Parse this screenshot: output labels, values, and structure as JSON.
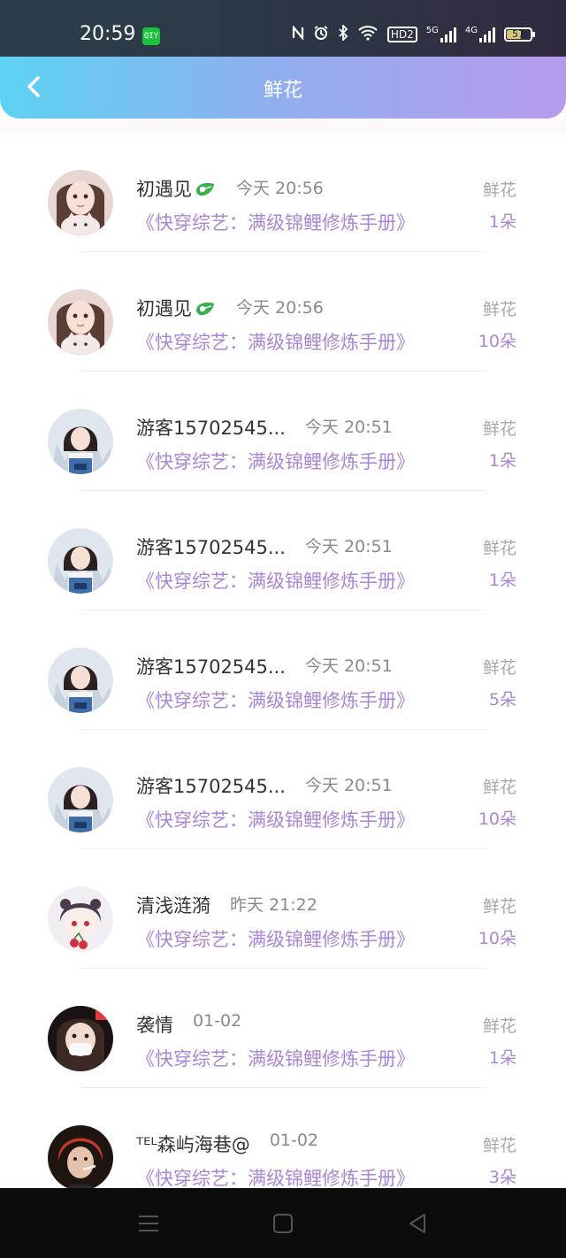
{
  "status_bar": {
    "time": "20:59",
    "app_badge": "QIY",
    "hd_label": "HD2",
    "net1_label": "5G",
    "net2_label": "4G",
    "battery": "57"
  },
  "header": {
    "title": "鲜花"
  },
  "items": [
    {
      "name": "初遇见",
      "has_leaf": true,
      "time": "今天 20:56",
      "book": "《快穿综艺：满级锦鲤修炼手册》",
      "label": "鲜花",
      "count": "1朵",
      "avatar": "girl-cat"
    },
    {
      "name": "初遇见",
      "has_leaf": true,
      "time": "今天 20:56",
      "book": "《快穿综艺：满级锦鲤修炼手册》",
      "label": "鲜花",
      "count": "10朵",
      "avatar": "girl-cat"
    },
    {
      "name": "游客15702545...",
      "has_leaf": false,
      "time": "今天 20:51",
      "book": "《快穿综艺：满级锦鲤修炼手册》",
      "label": "鲜花",
      "count": "1朵",
      "avatar": "girl-overalls"
    },
    {
      "name": "游客15702545...",
      "has_leaf": false,
      "time": "今天 20:51",
      "book": "《快穿综艺：满级锦鲤修炼手册》",
      "label": "鲜花",
      "count": "1朵",
      "avatar": "girl-overalls"
    },
    {
      "name": "游客15702545...",
      "has_leaf": false,
      "time": "今天 20:51",
      "book": "《快穿综艺：满级锦鲤修炼手册》",
      "label": "鲜花",
      "count": "5朵",
      "avatar": "girl-overalls"
    },
    {
      "name": "游客15702545...",
      "has_leaf": false,
      "time": "今天 20:51",
      "book": "《快穿综艺：满级锦鲤修炼手册》",
      "label": "鲜花",
      "count": "10朵",
      "avatar": "girl-overalls"
    },
    {
      "name": "清浅涟漪",
      "has_leaf": false,
      "time": "昨天 21:22",
      "book": "《快穿综艺：满级锦鲤修炼手册》",
      "label": "鲜花",
      "count": "10朵",
      "avatar": "cartoon-cherry"
    },
    {
      "name": "袭情",
      "has_leaf": false,
      "time": "01-02",
      "book": "《快穿综艺：满级锦鲤修炼手册》",
      "label": "鲜花",
      "count": "1朵",
      "avatar": "child-mask"
    },
    {
      "name": "ᵀᴱᴸ森屿海巷@",
      "has_leaf": false,
      "time": "01-02",
      "book": "《快穿综艺：满级锦鲤修炼手册》",
      "label": "鲜花",
      "count": "3朵",
      "avatar": "boy-redhair"
    }
  ],
  "nav_bar": {
    "menu": "menu-icon",
    "home": "home-icon",
    "back": "back-triangle-icon"
  }
}
